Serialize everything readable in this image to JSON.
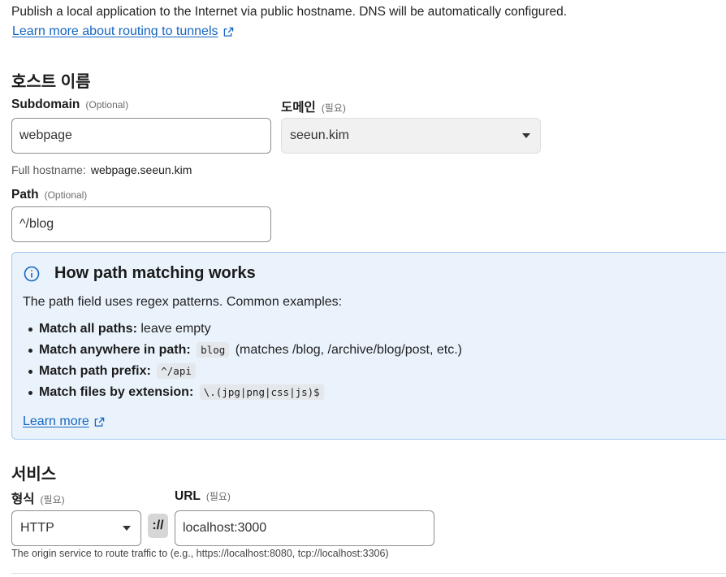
{
  "intro": {
    "text": "Publish a local application to the Internet via public hostname. DNS will be automatically configured.",
    "link": "Learn more about routing to tunnels"
  },
  "hostname": {
    "title": "호스트 이름",
    "subdomain": {
      "label": "Subdomain",
      "tag": "(Optional)",
      "value": "webpage"
    },
    "domain": {
      "label": "도메인",
      "tag": "(필요)",
      "value": "seeun.kim"
    },
    "full_hostname": {
      "label": "Full hostname:",
      "value": "webpage.seeun.kim"
    },
    "path": {
      "label": "Path",
      "tag": "(Optional)",
      "value": "^/blog"
    }
  },
  "info": {
    "title": "How path matching works",
    "description": "The path field uses regex patterns. Common examples:",
    "items": [
      {
        "label": "Match all paths:",
        "text": "leave empty",
        "code": "",
        "after": ""
      },
      {
        "label": "Match anywhere in path:",
        "text": "",
        "code": "blog",
        "after": "(matches /blog, /archive/blog/post, etc.)"
      },
      {
        "label": "Match path prefix:",
        "text": "",
        "code": "^/api",
        "after": ""
      },
      {
        "label": "Match files by extension:",
        "text": "",
        "code": "\\.(jpg|png|css|js)$",
        "after": ""
      }
    ],
    "link": "Learn more"
  },
  "service": {
    "title": "서비스",
    "type": {
      "label": "형식",
      "tag": "(필요)",
      "value": "HTTP"
    },
    "separator": "://",
    "url": {
      "label": "URL",
      "tag": "(필요)",
      "value": "localhost:3000"
    },
    "help": "The origin service to route traffic to (e.g., https://localhost:8080, tcp://localhost:3306)"
  },
  "colors": {
    "link": "#1565c0",
    "info_bg": "#eaf3fc",
    "info_border": "#a7c9ee"
  }
}
